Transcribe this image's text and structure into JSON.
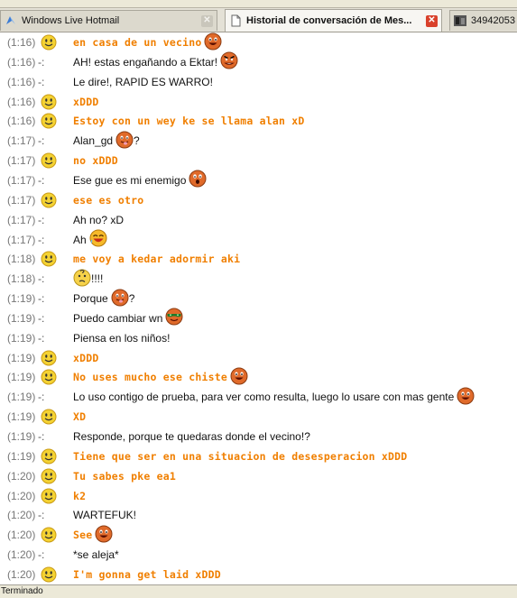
{
  "tabs": [
    {
      "label": "Windows Live Hotmail",
      "active": false
    },
    {
      "label": "Historial de conversación de Mes...",
      "active": true
    },
    {
      "label": "34942053",
      "active": false
    }
  ],
  "messages": [
    {
      "time": "(1:16)",
      "from": "smiley",
      "text": "en casa de un vecino",
      "emoticon": "grin"
    },
    {
      "time": "(1:16)",
      "from": "-:",
      "text": "AH! estas engañando a Ektar!",
      "emoticon": "angry"
    },
    {
      "time": "(1:16)",
      "from": "-:",
      "text": "Le dire!, RAPID ES WARRO!",
      "emoticon": ""
    },
    {
      "time": "(1:16)",
      "from": "smiley",
      "text": "xDDD",
      "emoticon": ""
    },
    {
      "time": "(1:16)",
      "from": "smiley",
      "text": "Estoy con un wey ke se llama alan xD",
      "emoticon": ""
    },
    {
      "time": "(1:17)",
      "from": "-:",
      "text": "Alan_gd",
      "emoticon": "tongue",
      "suffix": "?"
    },
    {
      "time": "(1:17)",
      "from": "smiley",
      "text": "no xDDD",
      "emoticon": ""
    },
    {
      "time": "(1:17)",
      "from": "-:",
      "text": "Ese gue es mi enemigo",
      "emoticon": "surprised"
    },
    {
      "time": "(1:17)",
      "from": "smiley",
      "text": "ese es otro",
      "emoticon": ""
    },
    {
      "time": "(1:17)",
      "from": "-:",
      "text": "Ah no? xD",
      "emoticon": ""
    },
    {
      "time": "(1:17)",
      "from": "-:",
      "text": "Ah",
      "emoticon": "laugh"
    },
    {
      "time": "(1:18)",
      "from": "smiley",
      "text": "me voy a kedar adormir aki",
      "emoticon": ""
    },
    {
      "time": "(1:18)",
      "from": "-:",
      "text": "",
      "emoticon": "confused",
      "suffix": "!!!!"
    },
    {
      "time": "(1:19)",
      "from": "-:",
      "text": "Porque",
      "emoticon": "tongue",
      "suffix": "?"
    },
    {
      "time": "(1:19)",
      "from": "-:",
      "text": "Puedo cambiar wn",
      "emoticon": "cool"
    },
    {
      "time": "(1:19)",
      "from": "-:",
      "text": "Piensa en los niños!",
      "emoticon": ""
    },
    {
      "time": "(1:19)",
      "from": "smiley",
      "text": "xDDD",
      "emoticon": ""
    },
    {
      "time": "(1:19)",
      "from": "smiley",
      "text": "No uses mucho ese chiste",
      "emoticon": "grin"
    },
    {
      "time": "(1:19)",
      "from": "-:",
      "text": "Lo uso contigo de prueba, para ver como resulta, luego lo usare con mas gente",
      "emoticon": "grin"
    },
    {
      "time": "(1:19)",
      "from": "smiley",
      "text": "XD",
      "emoticon": ""
    },
    {
      "time": "(1:19)",
      "from": "-:",
      "text": "Responde, porque te quedaras donde el vecino!?",
      "emoticon": ""
    },
    {
      "time": "(1:19)",
      "from": "smiley",
      "text": "Tiene que ser en una situacion de desesperacion xDDD",
      "emoticon": ""
    },
    {
      "time": "(1:20)",
      "from": "smiley",
      "text": "Tu sabes pke ea1",
      "emoticon": ""
    },
    {
      "time": "(1:20)",
      "from": "smiley",
      "text": "k2",
      "emoticon": ""
    },
    {
      "time": "(1:20)",
      "from": "-:",
      "text": "WARTEFUK!",
      "emoticon": ""
    },
    {
      "time": "(1:20)",
      "from": "smiley",
      "text": "See",
      "emoticon": "grin"
    },
    {
      "time": "(1:20)",
      "from": "-:",
      "text": "*se aleja*",
      "emoticon": ""
    },
    {
      "time": "(1:20)",
      "from": "smiley",
      "text": "I'm gonna get laid xDDD",
      "emoticon": ""
    }
  ],
  "status": {
    "text": "Terminado"
  },
  "colors": {
    "orange_text": "#f07f00",
    "timestamp": "#777777",
    "status_bg": "#ece9d8"
  }
}
